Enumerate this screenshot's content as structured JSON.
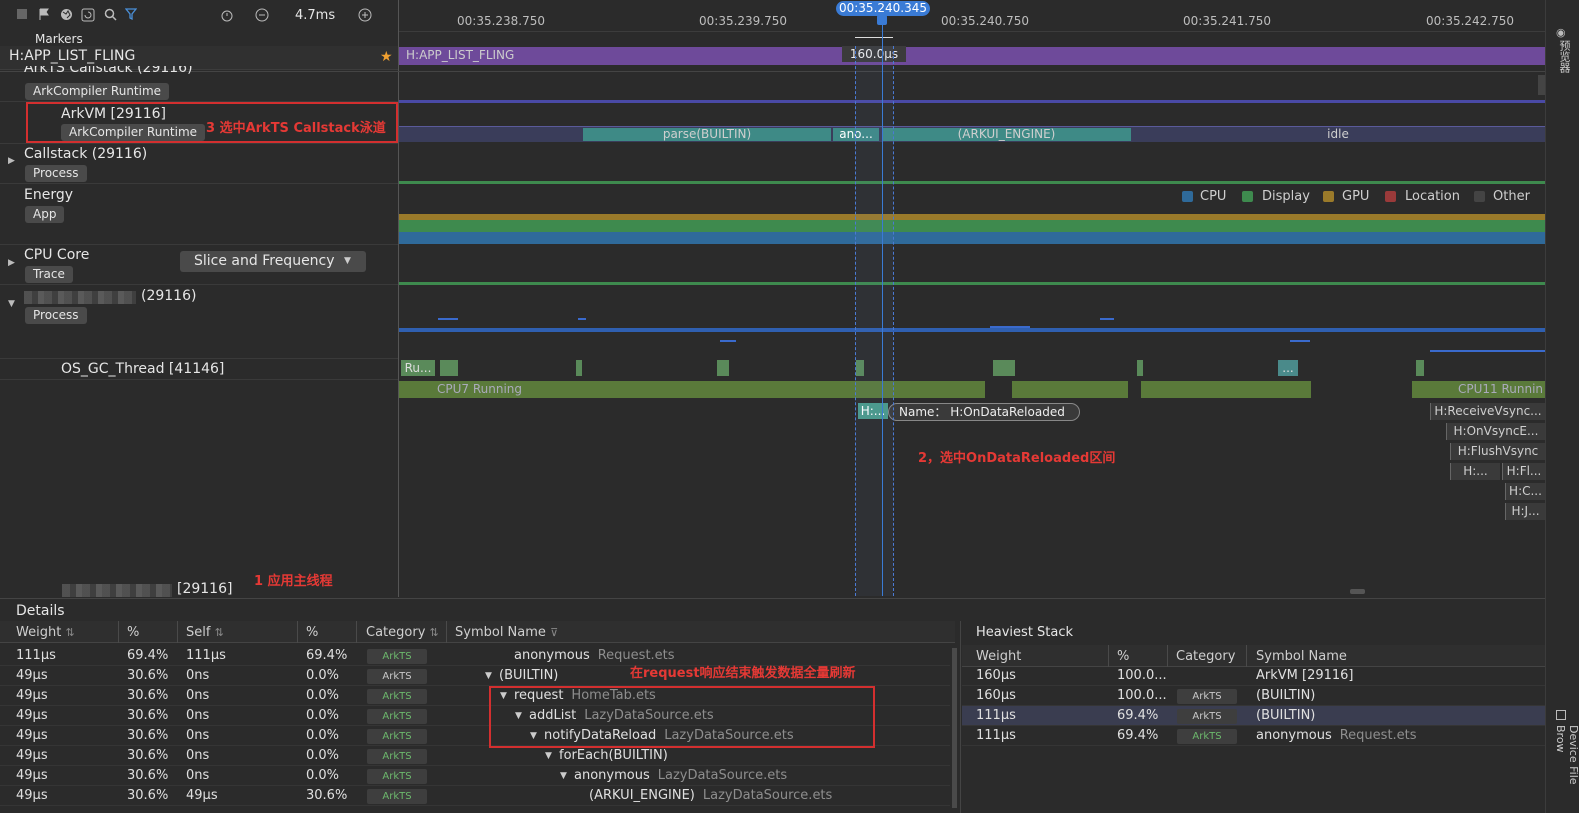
{
  "toolbar": {
    "zoom_value": "4.7ms"
  },
  "timeline": {
    "ticks": [
      "00:35.238.750",
      "00:35.239.750",
      "00:35.240.750",
      "00:35.241.750",
      "00:35.242.750"
    ],
    "cursor_time": "00:35.240.345",
    "range_label": "160.0μs"
  },
  "markers": {
    "label": "Markers",
    "pinned_row": "H:APP_LIST_FLING",
    "track_label": "H:APP_LIST_FLING"
  },
  "rows": {
    "arkts_callstack": "ArkTS Callstack (29116)",
    "arkcompiler_runtime_1": "ArkCompiler Runtime",
    "arkvm": "ArkVM [29116]",
    "arkcompiler_runtime_2": "ArkCompiler Runtime",
    "callstack": "Callstack (29116)",
    "callstack_tag": "Process",
    "energy": "Energy",
    "energy_tag": "App",
    "cpu_core": "CPU Core",
    "cpu_core_tag": "Trace",
    "slice_mode": "Slice and Frequency",
    "process_pid": "(29116)",
    "process_tag": "Process",
    "gc_thread": "OS_GC_Thread [41146]",
    "main_thread_pid": "[29116]"
  },
  "slices": {
    "parse": "parse(BUILTIN)",
    "ano": "ano...",
    "arkui": "(ARKUI_ENGINE)",
    "idle": "idle",
    "ru": "Ru...",
    "dots": "...",
    "cpu7": "CPU7 Running",
    "cpu11": "CPU11 Runnin",
    "h_short": "H:...",
    "tooltip_key": "Name：",
    "tooltip_value": "H:OnDataReloaded",
    "receive_vsync": "H:ReceiveVsync...",
    "on_vsync": "H:OnVsyncE...",
    "flush_vsync": "H:FlushVsync",
    "h_dots": "H:...",
    "h_fl": "H:Fl...",
    "h_c": "H:C...",
    "h_j": "H:J..."
  },
  "legend": [
    "CPU",
    "Display",
    "GPU",
    "Location",
    "Other"
  ],
  "legend_colors": [
    "#2f6a9a",
    "#3e8a4e",
    "#9a7a2a",
    "#9a3a3a",
    "#444444"
  ],
  "annotations": {
    "a1": "1   应用主线程",
    "a2": "2，选中OnDataReloaded区间",
    "a3": "3 选中ArkTS Callstack泳道",
    "a4": "在request响应结束触发数据全量刷新"
  },
  "details": {
    "title": "Details",
    "columns": [
      "Weight",
      "%",
      "Self",
      "%",
      "Category",
      "Symbol Name"
    ],
    "rows": [
      {
        "weight": "111μs",
        "pct": "69.4%",
        "self": "111μs",
        "spct": "69.4%",
        "cat": "ArkTS",
        "indent": 0,
        "arrow": "",
        "name": "anonymous",
        "file": "Request.ets"
      },
      {
        "weight": "49μs",
        "pct": "30.6%",
        "self": "0ns",
        "spct": "0.0%",
        "cat": "ArkTS",
        "indent": 0,
        "arrow": "▼",
        "name": "(BUILTIN)",
        "file": ""
      },
      {
        "weight": "49μs",
        "pct": "30.6%",
        "self": "0ns",
        "spct": "0.0%",
        "cat": "ArkTS",
        "indent": 1,
        "arrow": "▼",
        "name": "request",
        "file": "HomeTab.ets"
      },
      {
        "weight": "49μs",
        "pct": "30.6%",
        "self": "0ns",
        "spct": "0.0%",
        "cat": "ArkTS",
        "indent": 2,
        "arrow": "▼",
        "name": "addList",
        "file": "LazyDataSource.ets"
      },
      {
        "weight": "49μs",
        "pct": "30.6%",
        "self": "0ns",
        "spct": "0.0%",
        "cat": "ArkTS",
        "indent": 3,
        "arrow": "▼",
        "name": "notifyDataReload",
        "file": "LazyDataSource.ets"
      },
      {
        "weight": "49μs",
        "pct": "30.6%",
        "self": "0ns",
        "spct": "0.0%",
        "cat": "ArkTS",
        "indent": 4,
        "arrow": "▼",
        "name": "forEach(BUILTIN)",
        "file": ""
      },
      {
        "weight": "49μs",
        "pct": "30.6%",
        "self": "0ns",
        "spct": "0.0%",
        "cat": "ArkTS",
        "indent": 5,
        "arrow": "▼",
        "name": "anonymous",
        "file": "LazyDataSource.ets"
      },
      {
        "weight": "49μs",
        "pct": "30.6%",
        "self": "49μs",
        "spct": "30.6%",
        "cat": "ArkTS",
        "indent": 6,
        "arrow": "",
        "name": "(ARKUI_ENGINE)",
        "file": "LazyDataSource.ets"
      }
    ]
  },
  "heaviest": {
    "title": "Heaviest Stack",
    "columns": [
      "Weight",
      "%",
      "Category",
      "Symbol Name"
    ],
    "rows": [
      {
        "weight": "160μs",
        "pct": "100.0...",
        "cat": "",
        "name": "ArkVM [29116]",
        "file": ""
      },
      {
        "weight": "160μs",
        "pct": "100.0...",
        "cat": "ArkTS",
        "name": "(BUILTIN)",
        "file": ""
      },
      {
        "weight": "111μs",
        "pct": "69.4%",
        "cat": "ArkTS",
        "name": "(BUILTIN)",
        "file": ""
      },
      {
        "weight": "111μs",
        "pct": "69.4%",
        "cat": "ArkTS",
        "name": "anonymous",
        "file": "Request.ets"
      }
    ]
  },
  "side_panel": {
    "top_label": "预览器",
    "bottom_label": "Device File Brow"
  }
}
